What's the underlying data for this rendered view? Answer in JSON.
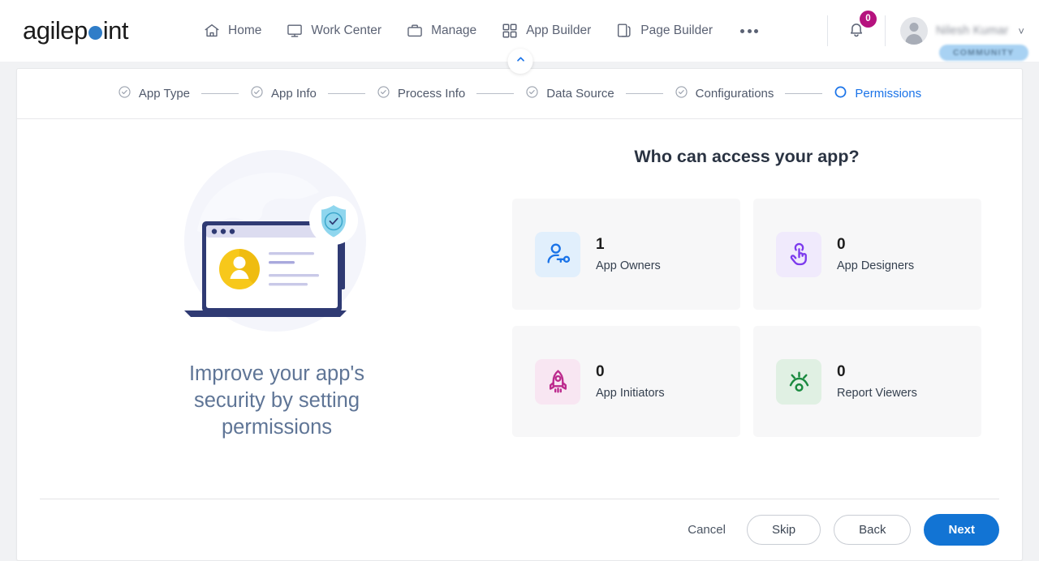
{
  "brand": {
    "name_part1": "agilep",
    "name_part2": "int",
    "dot_color": "#2f7dc8"
  },
  "nav": {
    "items": [
      {
        "label": "Home",
        "icon": "home-icon"
      },
      {
        "label": "Work Center",
        "icon": "monitor-icon"
      },
      {
        "label": "Manage",
        "icon": "briefcase-icon"
      },
      {
        "label": "App Builder",
        "icon": "grid-icon"
      },
      {
        "label": "Page Builder",
        "icon": "pages-icon"
      }
    ],
    "more_label": "More"
  },
  "header_right": {
    "notification_count": "0",
    "notification_badge_color": "#b5127e",
    "user_name": "Nilesh Kumar",
    "user_badge": "COMMUNITY",
    "caret": "˅"
  },
  "collapse": {
    "icon": "chevron-up-icon"
  },
  "stepper": {
    "steps": [
      {
        "label": "App Type",
        "state": "completed"
      },
      {
        "label": "App Info",
        "state": "completed"
      },
      {
        "label": "Process Info",
        "state": "completed"
      },
      {
        "label": "Data Source",
        "state": "completed"
      },
      {
        "label": "Configurations",
        "state": "completed"
      },
      {
        "label": "Permissions",
        "state": "active"
      }
    ],
    "active_color": "#1a73e8"
  },
  "promo": {
    "text": "Improve your app's security by setting permissions",
    "illustration": "laptop-security-shield-illustration"
  },
  "access": {
    "title": "Who can access your app?",
    "cards": [
      {
        "count": "1",
        "label": "App Owners",
        "icon": "user-key-icon",
        "icon_color": "#1a73e8",
        "tile_color": "#e1effc"
      },
      {
        "count": "0",
        "label": "App Designers",
        "icon": "tap-hand-icon",
        "icon_color": "#7c3aed",
        "tile_color": "#f0eafc"
      },
      {
        "count": "0",
        "label": "App Initiators",
        "icon": "rocket-icon",
        "icon_color": "#bc2a8d",
        "tile_color": "#f8e6f2"
      },
      {
        "count": "0",
        "label": "Report Viewers",
        "icon": "report-eye-icon",
        "icon_color": "#1a8a3f",
        "tile_color": "#e0f0e3"
      }
    ]
  },
  "footer": {
    "cancel_label": "Cancel",
    "skip_label": "Skip",
    "back_label": "Back",
    "next_label": "Next",
    "next_color": "#1274d4"
  }
}
